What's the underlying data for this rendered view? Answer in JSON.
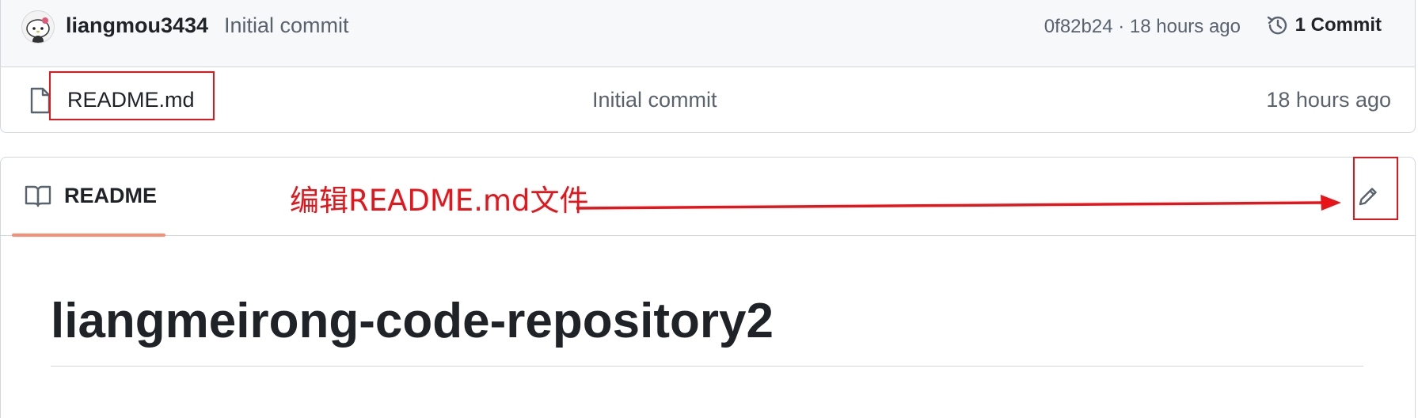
{
  "latest_commit": {
    "author": "liangmou3434",
    "message": "Initial commit",
    "hash_time": "0f82b24 · 18 hours ago",
    "commits_count": "1 Commit"
  },
  "files": [
    {
      "name": "README.md",
      "commit_message": "Initial commit",
      "age": "18 hours ago",
      "icon": "file-icon"
    }
  ],
  "readme": {
    "tab_label": "README",
    "title": "liangmeirong-code-repository2",
    "edit_icon": "pencil-icon"
  },
  "annotation": {
    "text": "编辑README.md文件",
    "color": "#e8141a"
  },
  "colors": {
    "tab_underline": "#fd8c73",
    "border": "#d0d7de",
    "muted_text": "#59636e"
  }
}
